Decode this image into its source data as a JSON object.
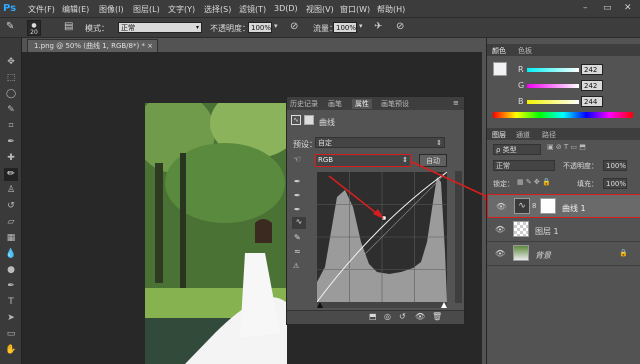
{
  "app": {
    "logo": "Ps"
  },
  "menu": [
    "文件(F)",
    "编辑(E)",
    "图像(I)",
    "图层(L)",
    "文字(Y)",
    "选择(S)",
    "滤镜(T)",
    "3D(D)",
    "视图(V)",
    "窗口(W)",
    "帮助(H)"
  ],
  "window_controls": {
    "minimize": "–",
    "restore": "▭",
    "close": "✕"
  },
  "options": {
    "brush_size": "20",
    "mode_label": "模式：",
    "mode_value": "正常",
    "opacity_label": "不透明度：",
    "opacity_value": "100%",
    "flow_label": "流量：",
    "flow_value": "100%"
  },
  "document": {
    "tab_title": "1.png @ 50% (曲线 1, RGB/8*) *",
    "tab_close": "×"
  },
  "properties": {
    "tabs": [
      "历史记录",
      "画笔",
      "属性",
      "画笔预设"
    ],
    "title": "曲线",
    "preset_label": "预设：",
    "preset_value": "自定",
    "channel_value": "RGB",
    "auto_button": "自动"
  },
  "color_panel": {
    "tabs": [
      "颜色",
      "色板"
    ],
    "r_label": "R",
    "g_label": "G",
    "b_label": "B",
    "r": "242",
    "g": "242",
    "b": "244"
  },
  "layers_panel": {
    "tabs": [
      "图层",
      "通道",
      "路径"
    ],
    "filter_label": "ρ 类型",
    "blend_mode": "正常",
    "opacity_label": "不透明度：",
    "opacity": "100%",
    "lock_label": "锁定：",
    "fill_label": "填充：",
    "fill": "100%",
    "layers": [
      {
        "name": "曲线 1",
        "type": "adjustment"
      },
      {
        "name": "图层 1",
        "type": "transparent"
      },
      {
        "name": "背景",
        "type": "image"
      }
    ]
  },
  "accent": "#d61e1e"
}
